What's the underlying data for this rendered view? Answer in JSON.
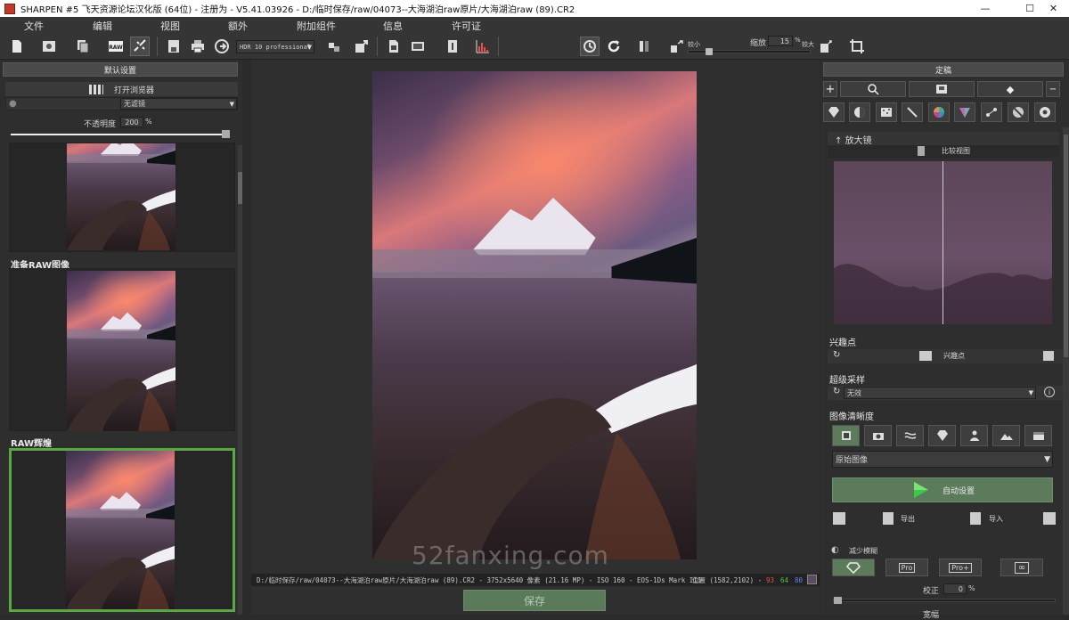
{
  "window": {
    "title": "SHARPEN #5 飞天资源论坛汉化版 (64位) - 注册为 - V5.41.03926 - D:/临时保存/raw/04073--大海湖泊raw原片/大海湖泊raw (89).CR2",
    "minimize": "—",
    "maximize": "☐",
    "close": "✕"
  },
  "menu": {
    "items": [
      "文件",
      "编辑",
      "视图",
      "额外",
      "附加组件",
      "信息",
      "许可证"
    ]
  },
  "toolbar": {
    "profile": "HDR 10 professional",
    "zoom_small_label": "较小",
    "zoom_label": "缩放",
    "zoom_value": "15",
    "zoom_unit": "%",
    "zoom_large_label": "较大",
    "zoom_level": 0.15
  },
  "left": {
    "default_settings": "默认设置",
    "open_browser": "打开浏览器",
    "filter_value": "无滤镜",
    "opacity_label": "不透明度",
    "opacity_value": "200",
    "opacity_unit": "%",
    "opacity_level": 1.0,
    "captions": [
      "准备RAW图像",
      "RAW辉煌"
    ]
  },
  "center": {
    "status": "D:/临时保存/raw/04073--大海湖泊raw原片/大海湖泊raw (89).CR2 - 3752x5640 像素 (21.16 MP) - ISO 160 - EOS-1Ds Mark III",
    "position_label": "位置 (1582,2102) -",
    "r": "93",
    "g": "64",
    "b": "80",
    "save": "保存",
    "watermark": "52fanxing.com"
  },
  "right": {
    "header": "定稿",
    "magnifier": "放大镜",
    "compare_view": "比较视图",
    "poi_title": "兴趣点",
    "poi_label": "兴趣点",
    "supersampling_title": "超级采样",
    "supersampling_value": "无效",
    "clarity_title": "图像清晰度",
    "clarity_value": "原始图像",
    "auto_settings": "自动设置",
    "export": "导出",
    "import": "导入",
    "reduce_blur": "减少模糊",
    "pro_labels": [
      "Pro",
      "Pro+"
    ],
    "correction_label": "校正",
    "correction_value": "0",
    "correction_unit": "%",
    "partial": "宽幅"
  },
  "colors": {
    "accent_green": "#5aa844",
    "bg": "#2b2b2b",
    "panel": "#2e2e2e",
    "red": "#e05050",
    "green": "#50c050",
    "blue": "#5070e0"
  }
}
